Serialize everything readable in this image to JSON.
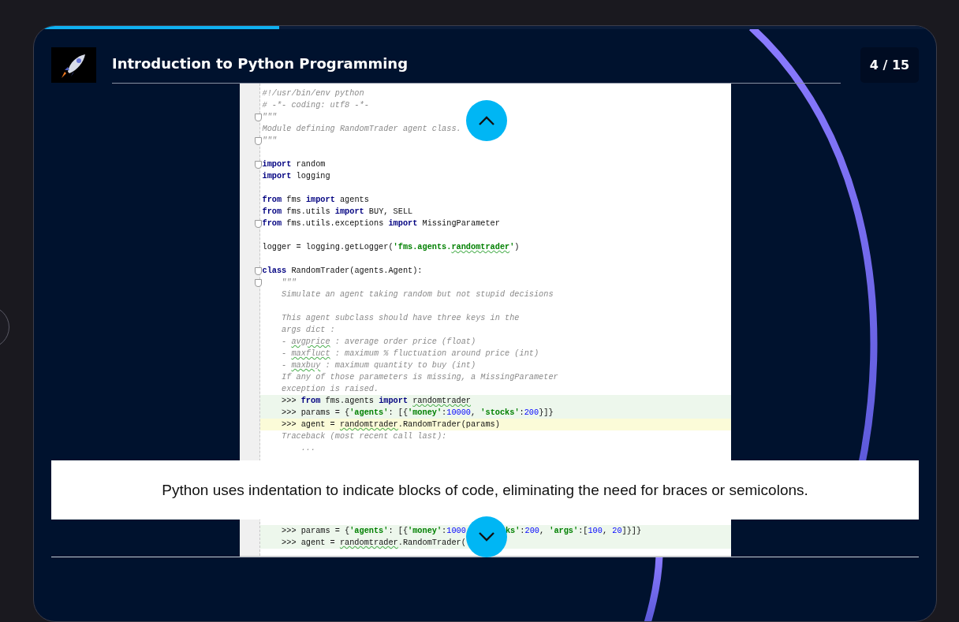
{
  "progress": {
    "level": 0.267
  },
  "header": {
    "title": "Introduction to Python Programming",
    "counter": "4 / 15"
  },
  "code_top": [
    {
      "kind": "code",
      "tokens": [
        {
          "kind": "com",
          "text": "#!/usr/bin/env python"
        }
      ]
    },
    {
      "kind": "code",
      "tokens": [
        {
          "kind": "com",
          "text": "# -*- coding: utf8 -*-"
        }
      ]
    },
    {
      "kind": "code",
      "fold": true,
      "tokens": [
        {
          "kind": "com",
          "text": "\"\"\""
        }
      ]
    },
    {
      "kind": "code",
      "tokens": [
        {
          "kind": "com",
          "text": "Module defining RandomTrader agent class."
        }
      ]
    },
    {
      "kind": "code",
      "fold": true,
      "tokens": [
        {
          "kind": "com",
          "text": "\"\"\""
        }
      ]
    },
    {
      "kind": "blank"
    },
    {
      "kind": "code",
      "fold": true,
      "tokens": [
        {
          "kind": "kw",
          "text": "import"
        },
        {
          "kind": "txt",
          "text": " random"
        }
      ]
    },
    {
      "kind": "code",
      "tokens": [
        {
          "kind": "kw",
          "text": "import"
        },
        {
          "kind": "txt",
          "text": " logging"
        }
      ]
    },
    {
      "kind": "blank"
    },
    {
      "kind": "code",
      "tokens": [
        {
          "kind": "kw",
          "text": "from"
        },
        {
          "kind": "txt",
          "text": " fms "
        },
        {
          "kind": "kw",
          "text": "import"
        },
        {
          "kind": "txt",
          "text": " agents"
        }
      ]
    },
    {
      "kind": "code",
      "tokens": [
        {
          "kind": "kw",
          "text": "from"
        },
        {
          "kind": "txt",
          "text": " fms.utils "
        },
        {
          "kind": "kw",
          "text": "import"
        },
        {
          "kind": "txt",
          "text": " BUY, SELL"
        }
      ]
    },
    {
      "kind": "code",
      "fold": true,
      "tokens": [
        {
          "kind": "kw",
          "text": "from"
        },
        {
          "kind": "txt",
          "text": " fms.utils.exceptions "
        },
        {
          "kind": "kw",
          "text": "import"
        },
        {
          "kind": "txt",
          "text": " MissingParameter"
        }
      ]
    },
    {
      "kind": "blank"
    },
    {
      "kind": "code",
      "tokens": [
        {
          "kind": "txt",
          "text": "logger = logging.getLogger("
        },
        {
          "kind": "str",
          "text": "'fms.agents."
        },
        {
          "kind": "str",
          "text": "randomtrader",
          "misspelled": true
        },
        {
          "kind": "str",
          "text": "'"
        },
        {
          "kind": "txt",
          "text": ")"
        }
      ]
    },
    {
      "kind": "blank"
    },
    {
      "kind": "code",
      "fold": true,
      "tokens": [
        {
          "kind": "kw",
          "text": "class"
        },
        {
          "kind": "txt",
          "text": " RandomTrader(agents.Agent):"
        }
      ]
    },
    {
      "kind": "code",
      "fold": true,
      "tokens": [
        {
          "kind": "com",
          "text": "    \"\"\""
        }
      ]
    },
    {
      "kind": "code",
      "tokens": [
        {
          "kind": "com",
          "text": "    Simulate an agent taking random but not stupid decisions"
        }
      ]
    },
    {
      "kind": "blank"
    },
    {
      "kind": "code",
      "tokens": [
        {
          "kind": "com",
          "text": "    This agent subclass should have three keys in the"
        }
      ]
    },
    {
      "kind": "code",
      "tokens": [
        {
          "kind": "com",
          "text": "    args dict :"
        }
      ]
    },
    {
      "kind": "code",
      "tokens": [
        {
          "kind": "com",
          "text": "    - "
        },
        {
          "kind": "com",
          "text": "avgprice",
          "misspelled": true
        },
        {
          "kind": "com",
          "text": " : average order price (float)"
        }
      ]
    },
    {
      "kind": "code",
      "tokens": [
        {
          "kind": "com",
          "text": "    - "
        },
        {
          "kind": "com",
          "text": "maxfluct",
          "misspelled": true
        },
        {
          "kind": "com",
          "text": " : maximum % fluctuation around price (int)"
        }
      ]
    },
    {
      "kind": "code",
      "tokens": [
        {
          "kind": "com",
          "text": "    - "
        },
        {
          "kind": "com",
          "text": "maxbuy",
          "misspelled": true
        },
        {
          "kind": "com",
          "text": " : maximum quantity to buy (int)"
        }
      ]
    },
    {
      "kind": "code",
      "tokens": [
        {
          "kind": "com",
          "text": "    If any of those parameters is missing, a MissingParameter"
        }
      ]
    },
    {
      "kind": "code",
      "tokens": [
        {
          "kind": "com",
          "text": "    exception is raised."
        }
      ]
    },
    {
      "kind": "code",
      "doctest": true,
      "tokens": [
        {
          "kind": "txt",
          "text": "    >>> "
        },
        {
          "kind": "kw",
          "text": "from"
        },
        {
          "kind": "txt",
          "text": " fms.agents "
        },
        {
          "kind": "kw",
          "text": "import "
        },
        {
          "kind": "txt",
          "text": "randomtrader",
          "misspelled": true
        }
      ]
    },
    {
      "kind": "code",
      "doctest": true,
      "tokens": [
        {
          "kind": "txt",
          "text": "    >>> params = {"
        },
        {
          "kind": "str",
          "text": "'agents'"
        },
        {
          "kind": "txt",
          "text": ": [{"
        },
        {
          "kind": "str",
          "text": "'money'"
        },
        {
          "kind": "txt",
          "text": ":"
        },
        {
          "kind": "num",
          "text": "10000"
        },
        {
          "kind": "txt",
          "text": ", "
        },
        {
          "kind": "str",
          "text": "'stocks'"
        },
        {
          "kind": "txt",
          "text": ":"
        },
        {
          "kind": "num",
          "text": "200"
        },
        {
          "kind": "txt",
          "text": "}]}"
        }
      ]
    },
    {
      "kind": "code",
      "current_line": true,
      "tokens": [
        {
          "kind": "txt",
          "text": "    >>> agent = "
        },
        {
          "kind": "txt",
          "text": "randomtrader",
          "misspelled": true
        },
        {
          "kind": "txt",
          "text": ".RandomTrader(params)"
        }
      ]
    },
    {
      "kind": "code",
      "tokens": [
        {
          "kind": "com",
          "text": "    Traceback (most recent call last):"
        }
      ]
    },
    {
      "kind": "code",
      "tokens": [
        {
          "kind": "com",
          "text": "        ..."
        }
      ]
    }
  ],
  "caption": "Python uses indentation to indicate blocks of code, eliminating the need for braces or semicolons.",
  "code_bottom": [
    {
      "kind": "code",
      "doctest": true,
      "tokens": [
        {
          "kind": "txt",
          "text": "    >>> params = {"
        },
        {
          "kind": "str",
          "text": "'agents'"
        },
        {
          "kind": "txt",
          "text": ": [{"
        },
        {
          "kind": "str",
          "text": "'money'"
        },
        {
          "kind": "txt",
          "text": ":"
        },
        {
          "kind": "num",
          "text": "1000"
        },
        {
          "kind": "gap"
        },
        {
          "kind": "str",
          "text": "ks'"
        },
        {
          "kind": "txt",
          "text": ":"
        },
        {
          "kind": "num",
          "text": "200"
        },
        {
          "kind": "txt",
          "text": ", "
        },
        {
          "kind": "str",
          "text": "'args'"
        },
        {
          "kind": "txt",
          "text": ":["
        },
        {
          "kind": "num",
          "text": "100"
        },
        {
          "kind": "txt",
          "text": ", "
        },
        {
          "kind": "num",
          "text": "20"
        },
        {
          "kind": "txt",
          "text": "]}]}"
        }
      ]
    },
    {
      "kind": "code",
      "doctest": true,
      "tokens": [
        {
          "kind": "txt",
          "text": "    >>> agent = "
        },
        {
          "kind": "txt",
          "text": "randomtrader",
          "misspelled": true
        },
        {
          "kind": "txt",
          "text": ".RandomTrader("
        }
      ]
    }
  ]
}
